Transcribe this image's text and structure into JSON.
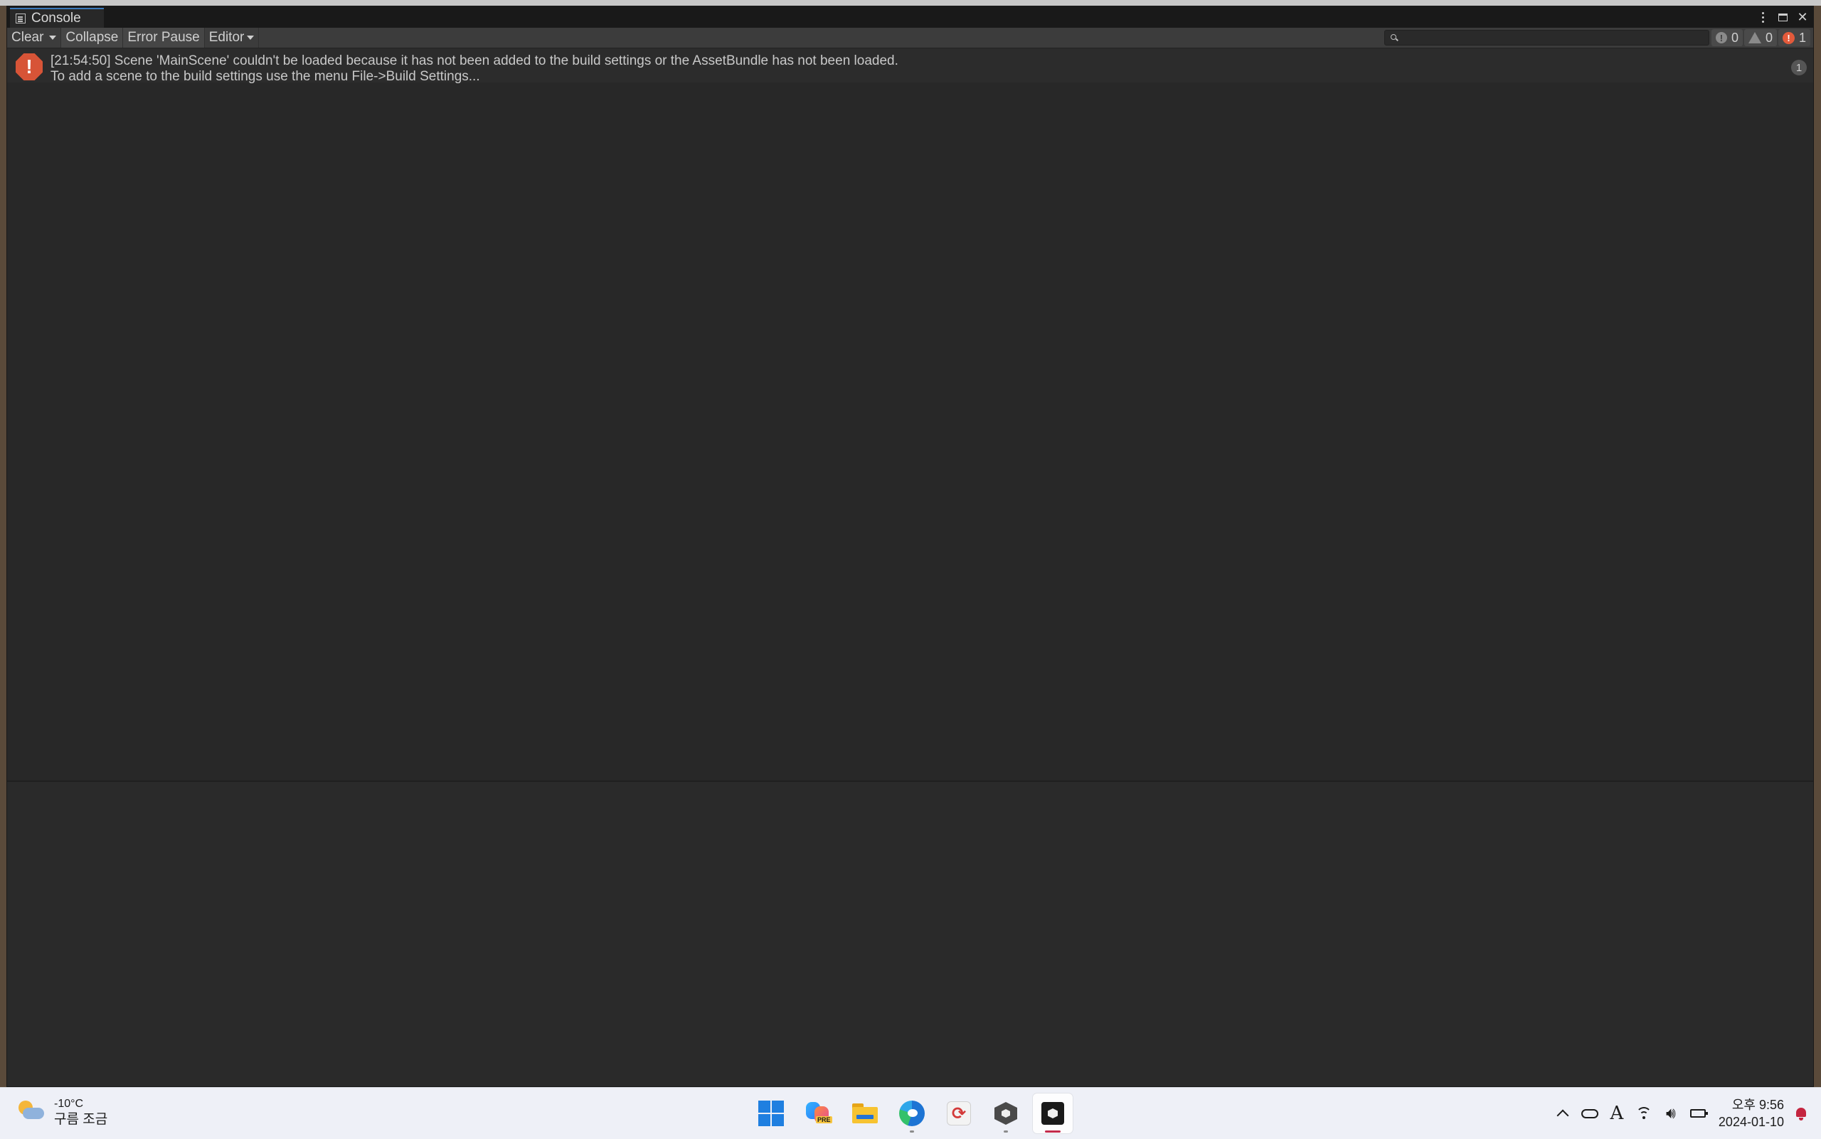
{
  "window": {
    "tab_title": "Console"
  },
  "toolbar": {
    "clear_label": "Clear",
    "collapse_label": "Collapse",
    "error_pause_label": "Error Pause",
    "editor_label": "Editor",
    "search_placeholder": "",
    "info_count": "0",
    "warning_count": "0",
    "error_count": "1"
  },
  "log": {
    "entries": [
      {
        "type": "error",
        "icon": "error-icon",
        "line1": "[21:54:50] Scene 'MainScene' couldn't be loaded because it has not been added to the build settings or the AssetBundle has not been loaded.",
        "line2": "To add a scene to the build settings use the menu File->Build Settings...",
        "count": "1"
      }
    ]
  },
  "taskbar": {
    "weather_temp": "-10°C",
    "weather_desc": "구름 조금",
    "apps": [
      "start-icon",
      "copilot-icon",
      "file-explorer-icon",
      "edge-icon",
      "sync-app-icon",
      "unity-hub-icon",
      "unity-editor-icon"
    ],
    "ime_label": "A",
    "clock_time": "오후 9:56",
    "clock_date": "2024-01-10"
  },
  "colors": {
    "error": "#d75437",
    "tab_accent": "#3a79bb",
    "panel_bg": "#282828",
    "taskbar_bg": "#eef0f7"
  }
}
